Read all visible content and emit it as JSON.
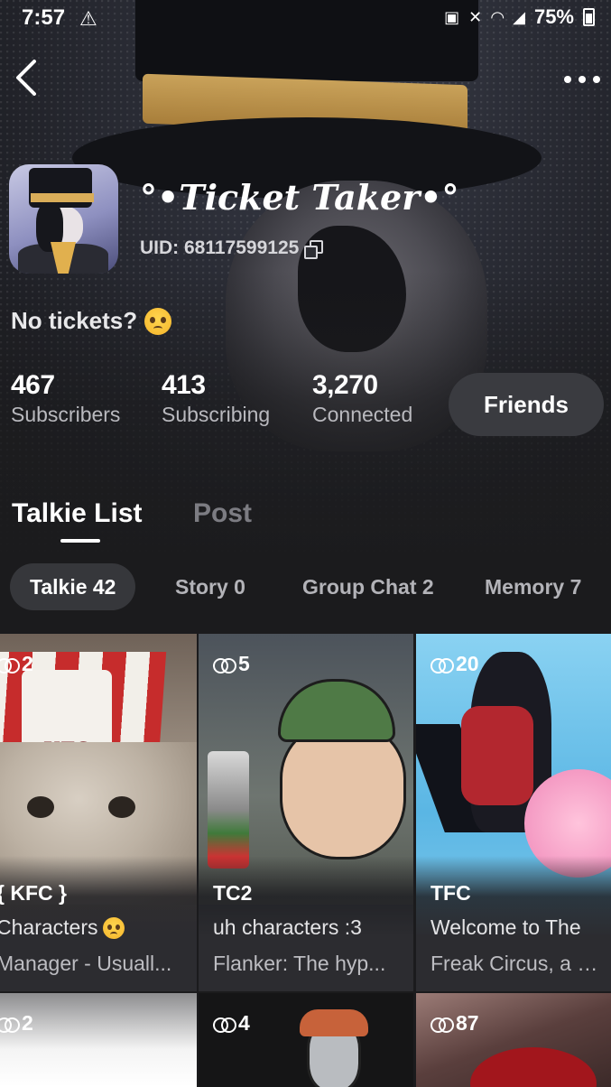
{
  "status_bar": {
    "time": "7:57",
    "battery": "75%"
  },
  "profile": {
    "name": "°•Ticket Taker•°",
    "uid": "UID: 68117599125",
    "bio": "No tickets?"
  },
  "stats": [
    {
      "value": "467",
      "label": "Subscribers"
    },
    {
      "value": "413",
      "label": "Subscribing"
    },
    {
      "value": "3,270",
      "label": "Connected"
    }
  ],
  "friends_button": "Friends",
  "tabs": [
    {
      "label": "Talkie List",
      "active": true
    },
    {
      "label": "Post",
      "active": false
    }
  ],
  "chips": [
    {
      "label": "Talkie 42",
      "active": true
    },
    {
      "label": "Story 0",
      "active": false
    },
    {
      "label": "Group Chat 2",
      "active": false
    },
    {
      "label": "Memory 7",
      "active": false
    }
  ],
  "cards": [
    {
      "count": "2",
      "title": "{ KFC }",
      "line1": "Characters",
      "line2": "Manager - Usuall..."
    },
    {
      "count": "5",
      "title": "TC2",
      "line1": "uh characters :3",
      "line2": "Flanker: The hyp..."
    },
    {
      "count": "20",
      "title": "TFC",
      "line1": "Welcome to The",
      "line2": "Freak Circus, a p..."
    },
    {
      "count": "2"
    },
    {
      "count": "4"
    },
    {
      "count": "87"
    }
  ],
  "colors": {
    "background": "#1b1b1d",
    "chip_active": "#36373b",
    "friends_button": "#3a3b40",
    "inactive_text": "#7c7c82"
  },
  "icons": [
    "back-arrow-icon",
    "more-options-icon",
    "copy-icon",
    "link-icon",
    "warning-icon",
    "wifi-icon",
    "mute-icon",
    "battery-icon"
  ]
}
